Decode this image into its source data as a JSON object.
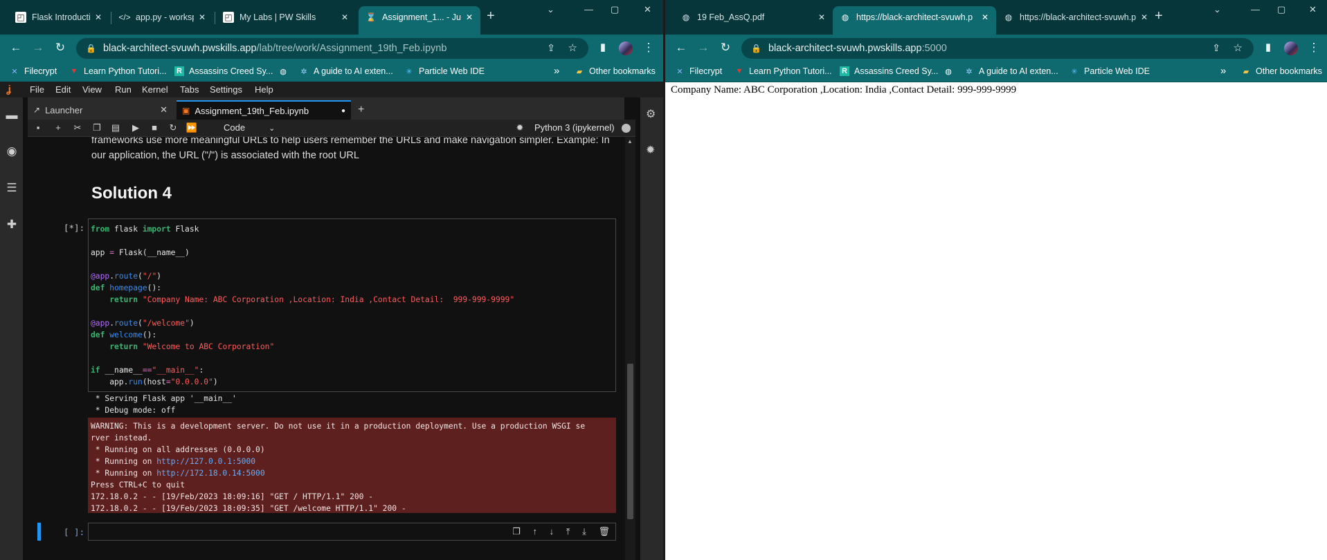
{
  "left_browser": {
    "tabs": [
      {
        "label": "Flask Introduction, A",
        "favicon": "pw-icon"
      },
      {
        "label": "app.py - workspace",
        "favicon": "code-icon"
      },
      {
        "label": "My Labs | PW Skills",
        "favicon": "pw-icon"
      },
      {
        "label": "Assignment_1... - Ju",
        "favicon": "hourglass-icon"
      }
    ],
    "url_host": "black-architect-svuwh.pwskills.app",
    "url_path": "/lab/tree/work/Assignment_19th_Feb.ipynb",
    "bookmarks": [
      "Filecrypt",
      "Learn Python Tutori...",
      "Assassins Creed Sy...",
      "",
      "A guide to AI exten...",
      "Particle Web IDE"
    ],
    "other_bookmarks": "Other bookmarks"
  },
  "jupyter": {
    "menu": [
      "File",
      "Edit",
      "View",
      "Run",
      "Kernel",
      "Tabs",
      "Settings",
      "Help"
    ],
    "tabs": [
      {
        "label": "Launcher"
      },
      {
        "label": "Assignment_19th_Feb.ipynb"
      }
    ],
    "cell_type": "Code",
    "kernel_name": "Python 3 (ipykernel)",
    "markdown_lines": [
      "frameworks use more meaningful URLs to help users remember the URLs and make navigation simpler. Example: In",
      "our application, the URL (\"/\") is associated with the root URL"
    ],
    "heading": "Solution 4",
    "code_prompt": "[*]:",
    "empty_prompt": "[ ]:",
    "stdout": " * Serving Flask app '__main__'\n * Debug mode: off",
    "stderr_lines": [
      "WARNING: This is a development server. Do not use it in a production deployment. Use a production WSGI se",
      "rver instead.",
      " * Running on all addresses (0.0.0.0)"
    ],
    "running_prefix": " * Running on ",
    "running_links": [
      "http://127.0.0.1:5000",
      "http://172.18.0.14:5000"
    ],
    "stderr_tail": [
      "Press CTRL+C to quit",
      "172.18.0.2 - - [19/Feb/2023 18:09:16] \"GET / HTTP/1.1\" 200 -",
      "172.18.0.2 - - [19/Feb/2023 18:09:35] \"GET /welcome HTTP/1.1\" 200 -"
    ]
  },
  "right_browser": {
    "tabs": [
      {
        "label": "19 Feb_AssQ.pdf",
        "favicon": "globe-icon"
      },
      {
        "label": "https://black-architect-svuwh.p",
        "favicon": "globe-icon"
      },
      {
        "label": "https://black-architect-svuwh.p",
        "favicon": "globe-icon"
      }
    ],
    "url_host": "black-architect-svuwh.pwskills.app",
    "url_port": ":5000",
    "bookmarks": [
      "Filecrypt",
      "Learn Python Tutori...",
      "Assassins Creed Sy...",
      "",
      "A guide to AI exten...",
      "Particle Web IDE"
    ],
    "other_bookmarks": "Other bookmarks",
    "page_text": "Company Name: ABC Corporation ,Location: India ,Contact Detail: 999-999-9999"
  },
  "colors": {
    "chrome_frame": "#06363a",
    "chrome_toolbar": "#0f6a70",
    "jupyter_bg": "#111111",
    "stderr_bg": "#5e1f1f",
    "accent": "#2196f3"
  }
}
